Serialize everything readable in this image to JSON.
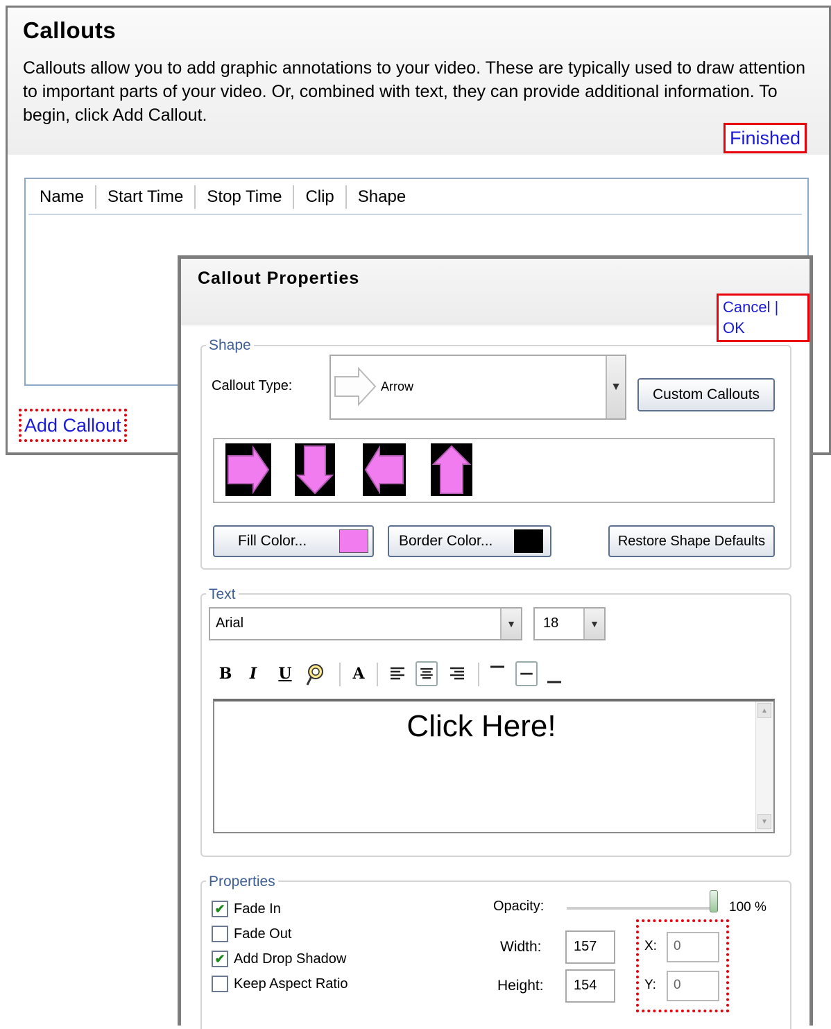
{
  "callouts": {
    "title": "Callouts",
    "description": "Callouts allow you to add graphic annotations to your video. These are typically used to draw attention to important parts of your video. Or, combined with text, they can provide additional information. To begin, click Add Callout.",
    "finished_label": "Finished",
    "columns": [
      "Name",
      "Start Time",
      "Stop Time",
      "Clip",
      "Shape"
    ],
    "add_callout_label": "Add Callout"
  },
  "dialog": {
    "title": "Callout Properties",
    "cancel_label": "Cancel",
    "separator": "|",
    "ok_label": "OK",
    "shape": {
      "legend": "Shape",
      "callout_type_label": "Callout Type:",
      "callout_type_value": "Arrow",
      "custom_callouts_label": "Custom Callouts",
      "fill_color_label": "Fill Color...",
      "fill_color": "#f07cf0",
      "border_color_label": "Border Color...",
      "border_color": "#000000",
      "restore_label": "Restore Shape Defaults",
      "gallery": [
        "arrow-right-icon",
        "arrow-down-icon",
        "arrow-left-icon",
        "arrow-up-icon"
      ]
    },
    "text": {
      "legend": "Text",
      "font": "Arial",
      "size": "18",
      "bold": "B",
      "italic": "I",
      "underline": "U",
      "font_color": "A",
      "editor_text": "Click Here!"
    },
    "properties": {
      "legend": "Properties",
      "fade_in": {
        "label": "Fade In",
        "checked": true
      },
      "fade_out": {
        "label": "Fade Out",
        "checked": false
      },
      "drop_shadow": {
        "label": "Add Drop Shadow",
        "checked": true
      },
      "keep_aspect": {
        "label": "Keep Aspect Ratio",
        "checked": false
      },
      "opacity_label": "Opacity:",
      "opacity_value": "100 %",
      "opacity": 1.0,
      "width_label": "Width:",
      "width_value": "157",
      "height_label": "Height:",
      "height_value": "154",
      "x_label": "X:",
      "x_value": "0",
      "y_label": "Y:",
      "y_value": "0"
    }
  }
}
